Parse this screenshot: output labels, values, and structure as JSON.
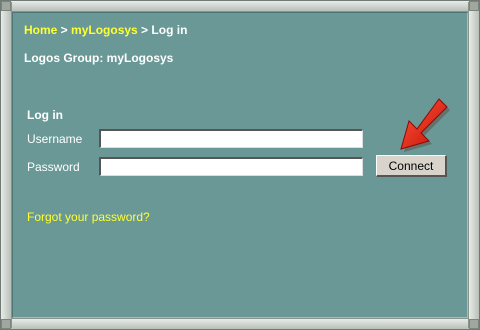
{
  "breadcrumb": {
    "home": "Home",
    "sep1": " > ",
    "mylogosys": "myLogosys",
    "sep2": " > ",
    "current": "Log in"
  },
  "group_line": "Logos Group: myLogosys",
  "login": {
    "title": "Log in",
    "username_label": "Username",
    "username_value": "",
    "password_label": "Password",
    "password_value": "",
    "connect_label": "Connect",
    "forgot_link": "Forgot your password?"
  },
  "colors": {
    "panel_bg": "#699896",
    "link": "#ffff33",
    "text": "#ffffff",
    "arrow": "#e8140c"
  },
  "icons": {
    "pointer": "red-arrow-icon"
  }
}
